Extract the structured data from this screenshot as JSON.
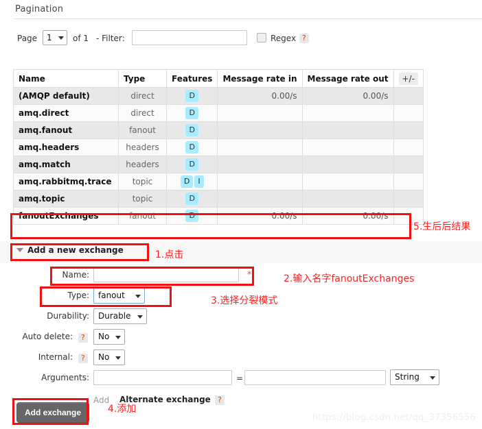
{
  "pagination": {
    "title": "Pagination",
    "page_label": "Page",
    "page_value": "1",
    "total_label": "of 1",
    "filter_label": "- Filter:",
    "filter_value": "",
    "filter_placeholder": "",
    "regex_label": "Regex",
    "help_glyph": "?"
  },
  "table": {
    "columns": [
      "Name",
      "Type",
      "Features",
      "Message rate in",
      "Message rate out"
    ],
    "plus_minus": "+/-",
    "rows": [
      {
        "name": "(AMQP default)",
        "type": "direct",
        "features": [
          "D"
        ],
        "rate_in": "0.00/s",
        "rate_out": "0.00/s"
      },
      {
        "name": "amq.direct",
        "type": "direct",
        "features": [
          "D"
        ],
        "rate_in": "",
        "rate_out": ""
      },
      {
        "name": "amq.fanout",
        "type": "fanout",
        "features": [
          "D"
        ],
        "rate_in": "",
        "rate_out": ""
      },
      {
        "name": "amq.headers",
        "type": "headers",
        "features": [
          "D"
        ],
        "rate_in": "",
        "rate_out": ""
      },
      {
        "name": "amq.match",
        "type": "headers",
        "features": [
          "D"
        ],
        "rate_in": "",
        "rate_out": ""
      },
      {
        "name": "amq.rabbitmq.trace",
        "type": "topic",
        "features": [
          "D",
          "I"
        ],
        "rate_in": "",
        "rate_out": ""
      },
      {
        "name": "amq.topic",
        "type": "topic",
        "features": [
          "D"
        ],
        "rate_in": "",
        "rate_out": ""
      },
      {
        "name": "fanoutExchanges",
        "type": "fanout",
        "features": [
          "D"
        ],
        "rate_in": "0.00/s",
        "rate_out": "0.00/s"
      }
    ]
  },
  "add_section": {
    "toggle_label": "Add a new exchange"
  },
  "form": {
    "name_label": "Name:",
    "name_value": "",
    "name_required_mark": "*",
    "type_label": "Type:",
    "type_value": "fanout",
    "durability_label": "Durability:",
    "durability_value": "Durable",
    "auto_delete_label": "Auto delete:",
    "auto_delete_value": "No",
    "internal_label": "Internal:",
    "internal_value": "No",
    "arguments_label": "Arguments:",
    "arguments_key_value": "",
    "arguments_equals": "=",
    "arguments_value_value": "",
    "arguments_type_value": "String",
    "add_link": "Add",
    "alternate_exchange_label": "Alternate exchange",
    "help_glyph": "?",
    "submit_label": "Add exchange"
  },
  "annotations": [
    {
      "id": "step-5",
      "text": "5.生后后结果"
    },
    {
      "id": "step-1",
      "text": "1.点击"
    },
    {
      "id": "step-2",
      "text": "2.输入名字fanoutExchanges"
    },
    {
      "id": "step-3",
      "text": "3.选择分裂模式"
    },
    {
      "id": "step-4",
      "text": "4.添加"
    }
  ],
  "watermark": {
    "text": "https://blog.csdn.net/qq_37356556"
  },
  "colors": {
    "annotation_red": "#fb2020",
    "feature_badge": "#a8edff",
    "submit_button": "#666666",
    "required_star": "#e05a2b"
  }
}
